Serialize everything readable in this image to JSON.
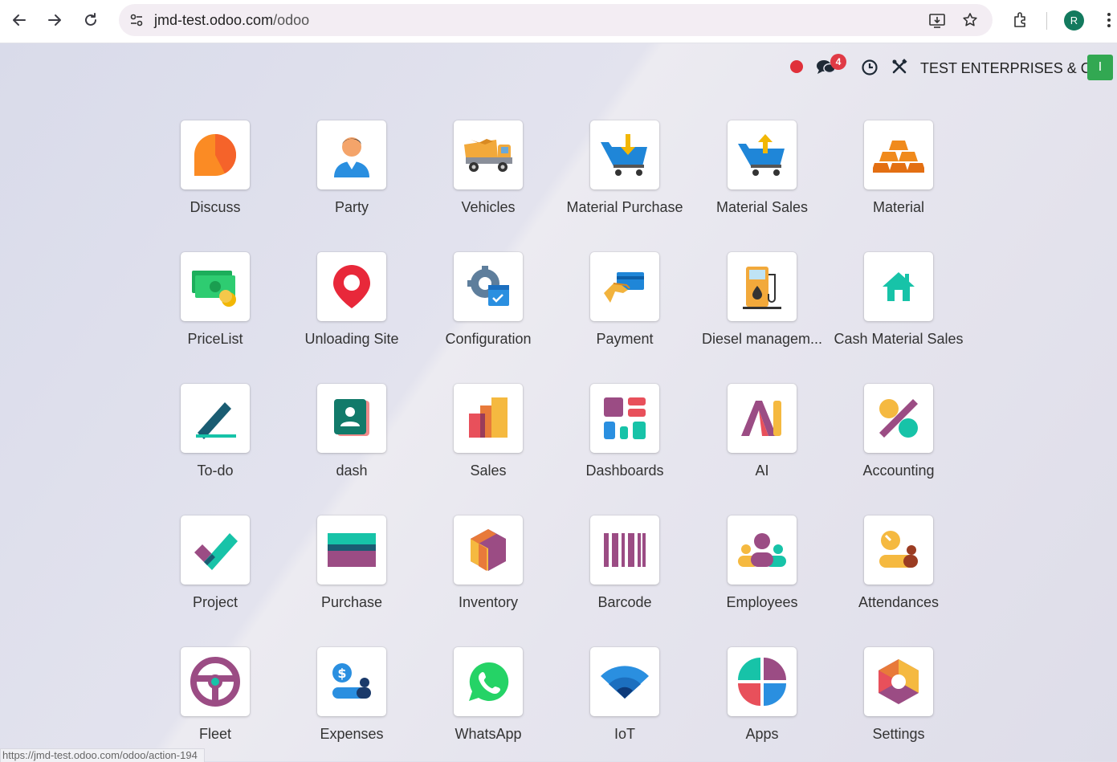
{
  "browser": {
    "url_host": "jmd-test.odoo.com",
    "url_path": "/odoo",
    "profile_initial": "R",
    "status_url": "https://jmd-test.odoo.com/odoo/action-194"
  },
  "topbar": {
    "chat_count": "4",
    "company": "TEST ENTERPRISES & CO",
    "user_initial": "I"
  },
  "apps": [
    {
      "label": "Discuss"
    },
    {
      "label": "Party"
    },
    {
      "label": "Vehicles"
    },
    {
      "label": "Material Purchase"
    },
    {
      "label": "Material Sales"
    },
    {
      "label": "Material"
    },
    {
      "label": "PriceList"
    },
    {
      "label": "Unloading Site"
    },
    {
      "label": "Configuration"
    },
    {
      "label": "Payment"
    },
    {
      "label": "Diesel managem..."
    },
    {
      "label": "Cash Material Sales"
    },
    {
      "label": "To-do"
    },
    {
      "label": "dash"
    },
    {
      "label": "Sales"
    },
    {
      "label": "Dashboards"
    },
    {
      "label": "AI"
    },
    {
      "label": "Accounting"
    },
    {
      "label": "Project"
    },
    {
      "label": "Purchase"
    },
    {
      "label": "Inventory"
    },
    {
      "label": "Barcode"
    },
    {
      "label": "Employees"
    },
    {
      "label": "Attendances"
    },
    {
      "label": "Fleet"
    },
    {
      "label": "Expenses"
    },
    {
      "label": "WhatsApp"
    },
    {
      "label": "IoT"
    },
    {
      "label": "Apps"
    },
    {
      "label": "Settings"
    }
  ]
}
